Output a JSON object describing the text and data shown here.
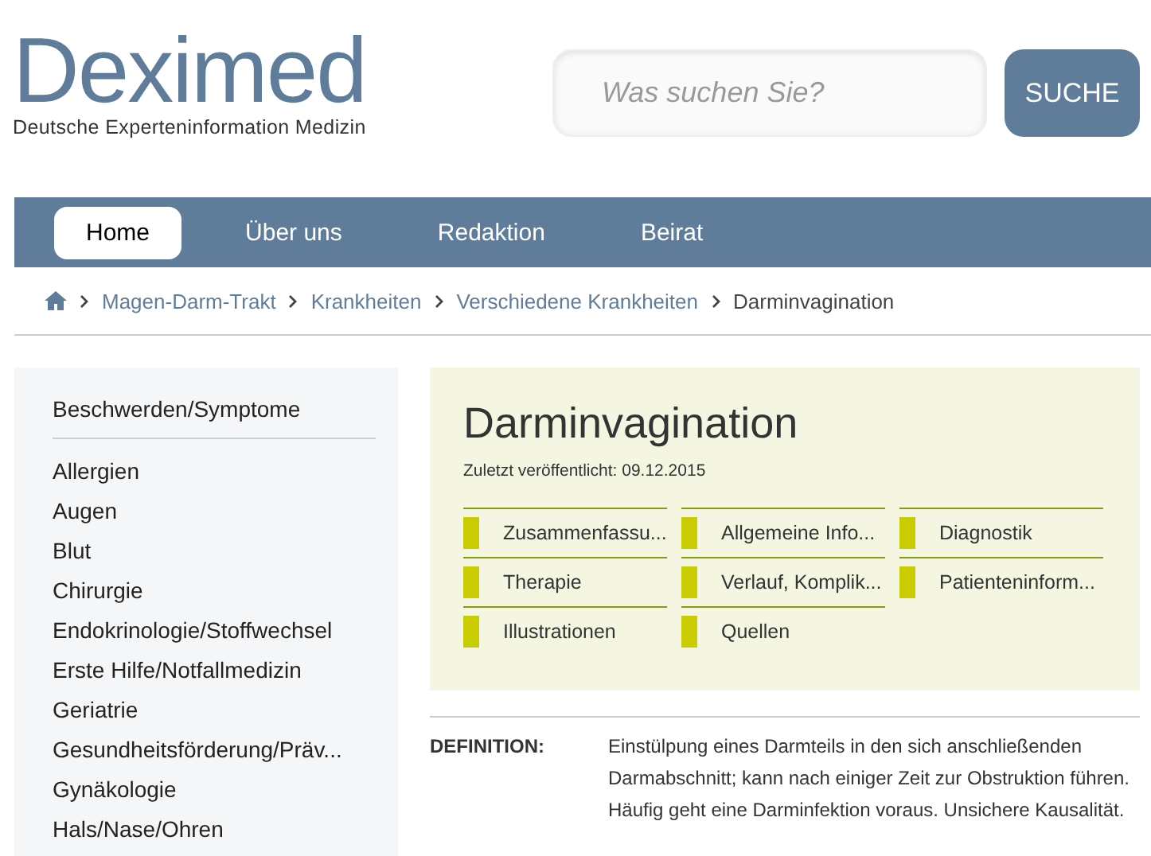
{
  "logo": {
    "name": "Deximed",
    "tagline": "Deutsche Experteninformation Medizin"
  },
  "search": {
    "placeholder": "Was suchen Sie?",
    "button": "SUCHE"
  },
  "nav": [
    {
      "label": "Home",
      "selected": true
    },
    {
      "label": "Über uns",
      "selected": false
    },
    {
      "label": "Redaktion",
      "selected": false
    },
    {
      "label": "Beirat",
      "selected": false
    }
  ],
  "breadcrumb": [
    "Magen-Darm-Trakt",
    "Krankheiten",
    "Verschiedene Krankheiten",
    "Darminvagination"
  ],
  "sidebar": {
    "heading": "Beschwerden/Symptome",
    "items": [
      "Allergien",
      "Augen",
      "Blut",
      "Chirurgie",
      "Endokrinologie/Stoffwechsel",
      "Erste Hilfe/Notfallmedizin",
      "Geriatrie",
      "Gesundheitsförderung/Präv...",
      "Gynäkologie",
      "Hals/Nase/Ohren"
    ]
  },
  "article": {
    "title": "Darminvagination",
    "published": "Zuletzt veröffentlicht: 09.12.2015",
    "sections": [
      "Zusammenfassu...",
      "Allgemeine Info...",
      "Diagnostik",
      "Therapie",
      "Verlauf, Komplik...",
      "Patienteninform...",
      "Illustrationen",
      "Quellen"
    ],
    "definition": {
      "label": "DEFINITION:",
      "text": "Einstülpung eines Darmteils in den sich anschließenden Darmabschnitt; kann nach einiger Zeit zur Obstruktion führen. Häufig geht eine Darminfektion voraus. Unsichere Kausalität."
    }
  }
}
